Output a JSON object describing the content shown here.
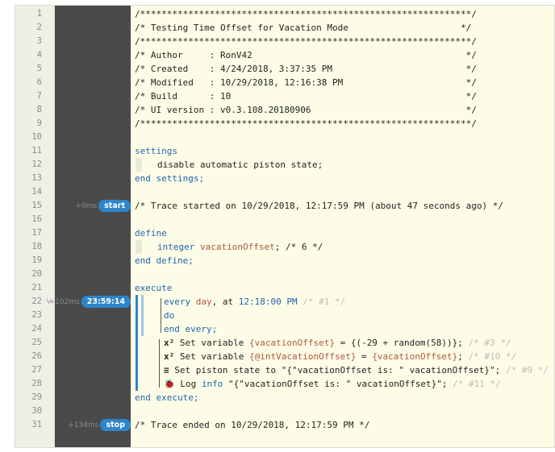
{
  "lines": [
    {
      "n": "1",
      "text": "/**************************************************************/"
    },
    {
      "n": "2",
      "text": "/* Testing Time Offset for Vacation Mode                     */"
    },
    {
      "n": "3",
      "text": "/**************************************************************/"
    },
    {
      "n": "4",
      "text": "/* Author     : RonV42                                        */"
    },
    {
      "n": "5",
      "text": "/* Created    : 4/24/2018, 3:37:35 PM                         */"
    },
    {
      "n": "6",
      "text": "/* Modified   : 10/29/2018, 12:16:38 PM                       */"
    },
    {
      "n": "7",
      "text": "/* Build      : 10                                            */"
    },
    {
      "n": "8",
      "text": "/* UI version : v0.3.108.20180906                             */"
    },
    {
      "n": "9",
      "text": "/**************************************************************/"
    },
    {
      "n": "10",
      "text": ""
    },
    {
      "n": "11",
      "text": "settings"
    },
    {
      "n": "12",
      "text": "disable automatic piston state;"
    },
    {
      "n": "13",
      "text": "end settings;"
    },
    {
      "n": "14",
      "text": ""
    },
    {
      "n": "15",
      "text": "/* Trace started on 10/29/2018, 12:17:59 PM (about 47 seconds ago) */"
    },
    {
      "n": "16",
      "text": ""
    },
    {
      "n": "17",
      "text": "define"
    },
    {
      "n": "18",
      "kw": "integer",
      "var": "vacationOffset",
      "rest": "; /* 6 */"
    },
    {
      "n": "19",
      "text": "end define;"
    },
    {
      "n": "20",
      "text": ""
    },
    {
      "n": "21",
      "text": "execute"
    },
    {
      "n": "22",
      "kw": "every",
      "var": "day",
      "rest": ", at",
      "time": "12:18:00 PM",
      "cm": "/* #1 */"
    },
    {
      "n": "23",
      "text": "do"
    },
    {
      "n": "24",
      "text": "end every;"
    },
    {
      "n": "25",
      "pre": "Set variable",
      "var": "{vacationOffset}",
      "mid": " = {(-29 + random(58))};",
      "cm": "/* #3 */"
    },
    {
      "n": "26",
      "pre": "Set variable",
      "var": "{@intVacationOffset}",
      "mid": " = ",
      "var2": "{vacationOffset}",
      "end": ";",
      "cm": "/* #10 */"
    },
    {
      "n": "27",
      "pre": "Set piston state to \"{\"vacationOffset is: \" vacationOffset}\";",
      "cm": "/* #9 */"
    },
    {
      "n": "28",
      "pre": "Log",
      "kw": "info",
      "mid": " \"{\"vacationOffset is: \" vacationOffset}\";",
      "cm": "/* #11 */"
    },
    {
      "n": "29",
      "text": "end execute;"
    },
    {
      "n": "30",
      "text": ""
    },
    {
      "n": "31",
      "text": "/* Trace ended on 10/29/2018, 12:17:59 PM */"
    }
  ],
  "traces": {
    "start": {
      "time": "+0ms",
      "label": "start"
    },
    "timer": {
      "time": "+102ms",
      "label": "23:59:14"
    },
    "stop": {
      "time": "+134ms",
      "label": "stop"
    }
  },
  "icons": {
    "set_variable": "x²",
    "set_state": "≡",
    "log": "🐞"
  }
}
